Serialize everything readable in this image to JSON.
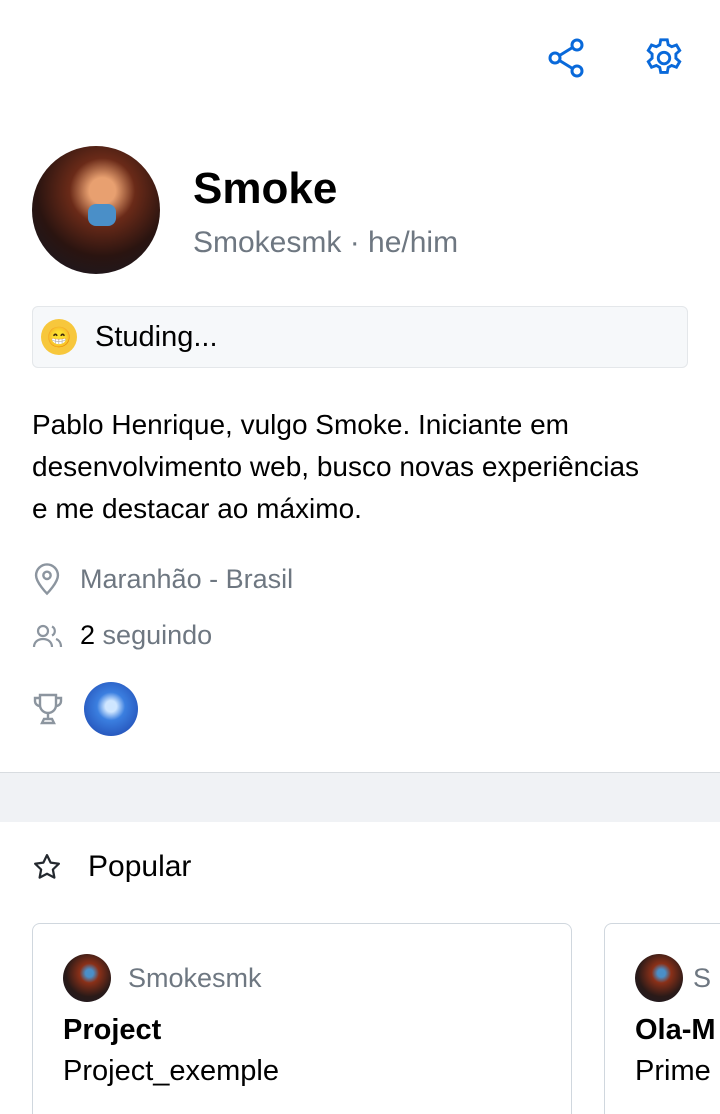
{
  "header": {
    "share_icon": "share-icon",
    "settings_icon": "gear-icon",
    "accent": "#0969da"
  },
  "profile": {
    "name": "Smoke",
    "username_line": "Smokesmk · he/him",
    "status_emoji": "😁",
    "status": "Studing...",
    "bio": "Pablo Henrique, vulgo Smoke. Iniciante em desenvolvimento web, busco novas experiências e me destacar ao máximo.",
    "location": "Maranhão - Brasil",
    "following_count": "2",
    "following_label": "seguindo"
  },
  "popular": {
    "title": "Popular",
    "cards": [
      {
        "owner": "Smokesmk",
        "title": "Project",
        "description": "Project_exemple"
      },
      {
        "owner": "S",
        "title": "Ola-M",
        "description": "Prime"
      }
    ]
  }
}
